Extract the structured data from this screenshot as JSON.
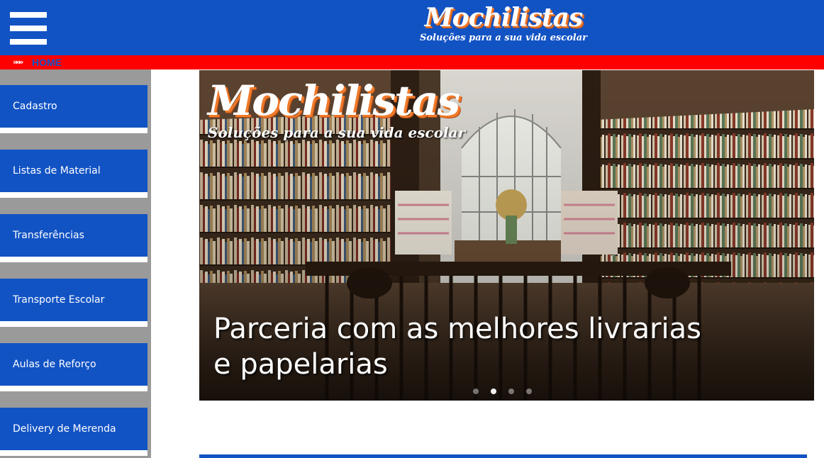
{
  "header": {
    "menu_icon": "hamburger-menu-icon",
    "logo_title": "Mochilistas",
    "logo_subtitle": "Soluções para a sua vida escolar",
    "background": "#1253c4"
  },
  "breadcrumb": {
    "icon": "chevrons-right-icon",
    "icon_glyph": "»»»",
    "label": "HOME",
    "background": "#ff0000"
  },
  "sidebar": {
    "items": [
      {
        "label": "Cadastro"
      },
      {
        "label": "Listas de Material"
      },
      {
        "label": "Transferências"
      },
      {
        "label": "Transporte Escolar"
      },
      {
        "label": "Aulas de Reforço"
      },
      {
        "label": "Delivery de Merenda"
      }
    ],
    "button_color": "#1253c4",
    "background": "#9a9a9a"
  },
  "carousel": {
    "logo_title": "Mochilistas",
    "logo_subtitle": "Soluções para a sua vida escolar",
    "caption_line1": "Parceria com as melhores livrarias",
    "caption_line2": "e papelarias",
    "slide_count": 4,
    "active_slide": 2
  },
  "accent_orange": "#f07a2a"
}
